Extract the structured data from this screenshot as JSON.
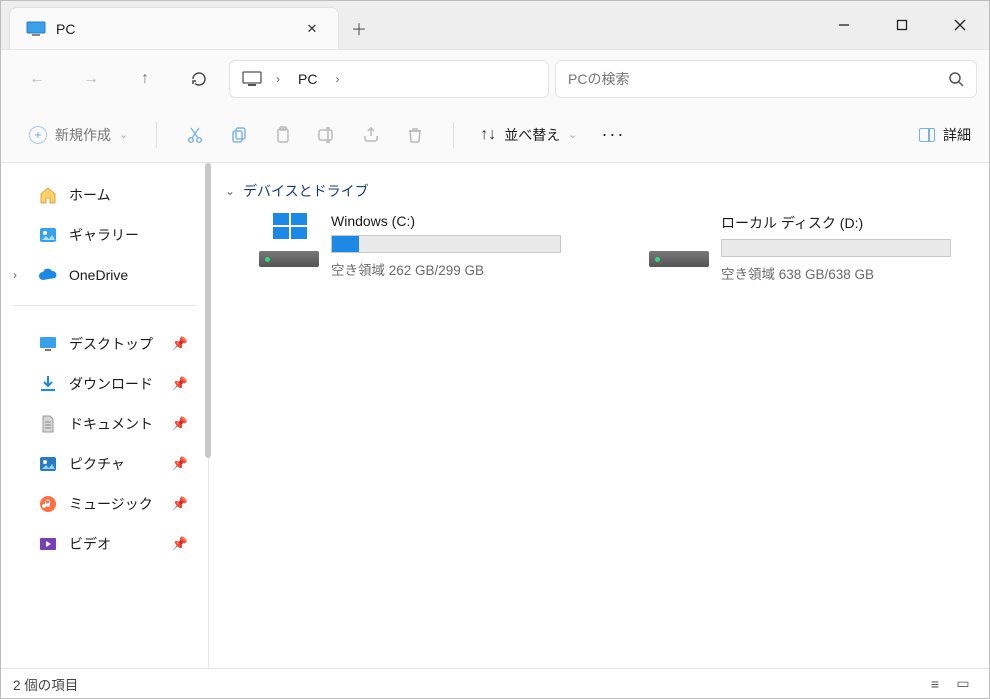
{
  "window": {
    "tab_title": "PC"
  },
  "address": {
    "location": "PC"
  },
  "search": {
    "placeholder": "PCの検索"
  },
  "toolbar": {
    "new_label": "新規作成",
    "sort_label": "並べ替え",
    "details_label": "詳細"
  },
  "sidebar": {
    "top": [
      {
        "label": "ホーム",
        "icon": "home",
        "expandable": false
      },
      {
        "label": "ギャラリー",
        "icon": "gallery",
        "expandable": false
      },
      {
        "label": "OneDrive",
        "icon": "onedrive",
        "expandable": true
      }
    ],
    "pinned": [
      {
        "label": "デスクトップ",
        "icon": "desktop"
      },
      {
        "label": "ダウンロード",
        "icon": "downloads"
      },
      {
        "label": "ドキュメント",
        "icon": "documents"
      },
      {
        "label": "ピクチャ",
        "icon": "pictures"
      },
      {
        "label": "ミュージック",
        "icon": "music"
      },
      {
        "label": "ビデオ",
        "icon": "videos"
      }
    ]
  },
  "content": {
    "group_title": "デバイスとドライブ",
    "drives": [
      {
        "name": "Windows (C:)",
        "sub": "空き領域 262 GB/299 GB",
        "fill_pct": 12,
        "winlogo": true
      },
      {
        "name": "ローカル ディスク (D:)",
        "sub": "空き領域 638 GB/638 GB",
        "fill_pct": 0,
        "winlogo": false
      }
    ]
  },
  "statusbar": {
    "text": "2 個の項目"
  },
  "colors": {
    "accent": "#1e88e5"
  }
}
